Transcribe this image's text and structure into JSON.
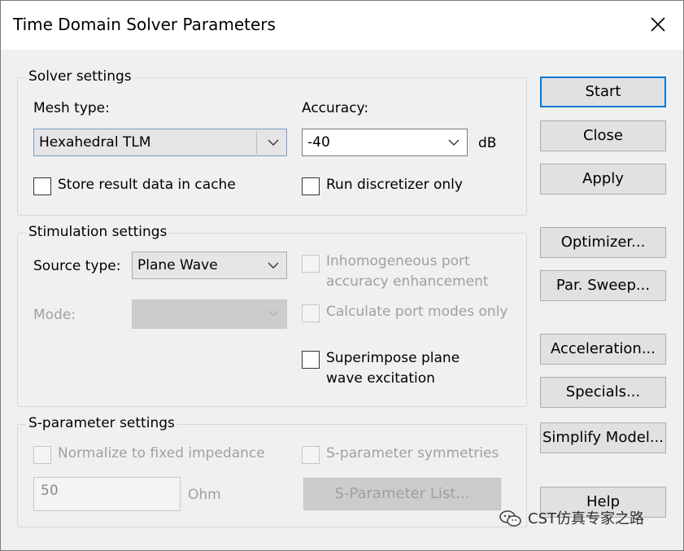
{
  "window": {
    "title": "Time Domain Solver Parameters"
  },
  "solver": {
    "group_title": "Solver settings",
    "mesh_type_label": "Mesh type:",
    "mesh_type_value": "Hexahedral TLM",
    "accuracy_label": "Accuracy:",
    "accuracy_value": "-40",
    "accuracy_unit": "dB",
    "store_cache_label": "Store result data in cache",
    "store_cache_checked": false,
    "run_discretizer_label": "Run discretizer only",
    "run_discretizer_checked": false
  },
  "stimulation": {
    "group_title": "Stimulation settings",
    "source_type_label": "Source type:",
    "source_type_value": "Plane Wave",
    "mode_label": "Mode:",
    "mode_value": "",
    "inhomogeneous_line1": "Inhomogeneous port",
    "inhomogeneous_line2": "accuracy enhancement",
    "calc_port_modes_label": "Calculate port modes only",
    "superimpose_line1": "Superimpose plane",
    "superimpose_line2": "wave excitation"
  },
  "sparam": {
    "group_title": "S-parameter settings",
    "normalize_label": "Normalize to fixed impedance",
    "symmetries_label": "S-parameter symmetries",
    "impedance_value": "50",
    "impedance_unit": "Ohm",
    "list_button": "S-Parameter List..."
  },
  "buttons": {
    "start": "Start",
    "close": "Close",
    "apply": "Apply",
    "optimizer": "Optimizer...",
    "par_sweep": "Par. Sweep...",
    "acceleration": "Acceleration...",
    "specials": "Specials...",
    "simplify_model": "Simplify Model...",
    "help": "Help"
  },
  "watermark": {
    "text": "CST仿真专家之路"
  },
  "colors": {
    "default_button_border": "#0078d7",
    "dialog_bg": "#f0f0f0",
    "disabled_text": "#a0a0a0"
  }
}
